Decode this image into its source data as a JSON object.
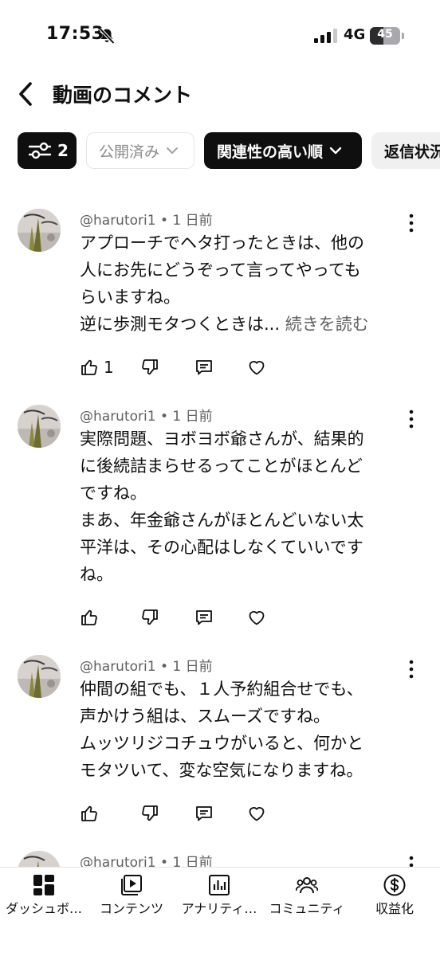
{
  "status_bar": {
    "time": "17:53",
    "network": "4G",
    "battery": "45",
    "battery_level": 0.45
  },
  "header": {
    "title": "動画のコメント",
    "back_icon": "chevron-left-icon"
  },
  "filters": {
    "filter_count": "2",
    "published_label": "公開済み",
    "sort_label": "関連性の高い順",
    "reply_status_label": "返信状況"
  },
  "comments": [
    {
      "author": "@harutori1",
      "time": "1 日前",
      "lines": [
        "アプローチでヘタ打ったときは、他の",
        "人にお先にどうぞって言ってやっても",
        "らいますね。",
        "逆に歩測モタつくときは..."
      ],
      "read_more": "続きを読む",
      "like_count": "1"
    },
    {
      "author": "@harutori1",
      "time": "1 日前",
      "lines": [
        "実際問題、ヨボヨボ爺さんが、結果的",
        "に後続詰まらせるってことがほとんど",
        "ですね。",
        "まあ、年金爺さんがほとんどいない太",
        "平洋は、その心配はしなくていいです",
        "ね。"
      ],
      "read_more": "",
      "like_count": ""
    },
    {
      "author": "@harutori1",
      "time": "1 日前",
      "lines": [
        "仲間の組でも、１人予約組合せでも、",
        "声かけう組は、スムーズですね。",
        "ムッツリジコチュウがいると、何かと",
        "モタツいて、変な空気になりますね。"
      ],
      "read_more": "",
      "like_count": ""
    },
    {
      "author": "@harutori1",
      "time": "1 日前",
      "lines": [],
      "read_more": "",
      "like_count": ""
    }
  ],
  "bottom_nav": [
    {
      "label": "ダッシュボ…",
      "icon": "dashboard-icon"
    },
    {
      "label": "コンテンツ",
      "icon": "content-icon"
    },
    {
      "label": "アナリティ…",
      "icon": "analytics-icon"
    },
    {
      "label": "コミュニティ",
      "icon": "community-icon"
    },
    {
      "label": "収益化",
      "icon": "monetization-icon"
    }
  ]
}
